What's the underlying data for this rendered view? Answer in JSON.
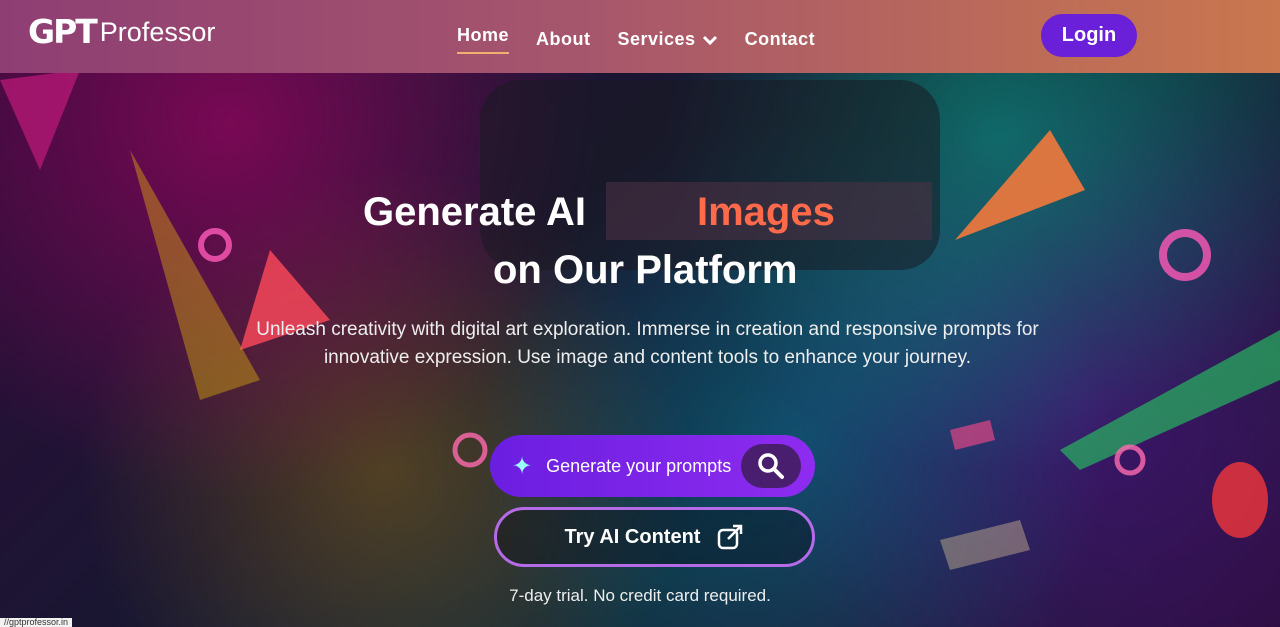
{
  "header": {
    "logo_mark": "GPT",
    "logo_word": "Professor",
    "nav": [
      {
        "label": "Home"
      },
      {
        "label": "About"
      },
      {
        "label": "Services"
      },
      {
        "label": "Contact"
      }
    ],
    "login_label": "Login"
  },
  "hero": {
    "title_line1": "Generate AI",
    "title_highlight": "Images",
    "title_line2": "on Our Platform",
    "description": "Unleash creativity with digital art exploration. Immerse in creation and responsive prompts for innovative expression. Use image and content tools to enhance your journey.",
    "prompt_button_label": "Generate your prompts",
    "try_button_label": "Try AI Content",
    "trial_note": "7-day trial. No credit card required."
  },
  "status": {
    "url": "//gptprofessor.in"
  },
  "colors": {
    "accent": "#ff6a4a",
    "primary": "#6b1ee0",
    "header_start": "#8e3e73",
    "header_end": "#c9774e"
  }
}
